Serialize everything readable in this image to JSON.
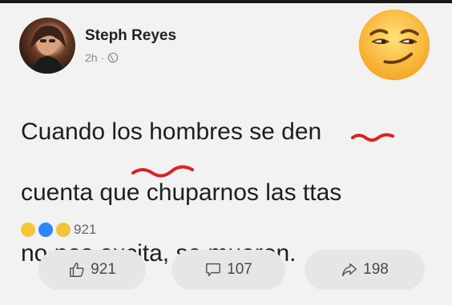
{
  "post": {
    "author": "Steph Reyes",
    "time": "2h",
    "separator": "·",
    "line1": "Cuando los hombres se den",
    "line2": "cuenta que chuparnos las ttas",
    "line3": "no nos excita, se mueren.",
    "reaction_count": "921"
  },
  "actions": {
    "like_count": "921",
    "comment_count": "107",
    "share_count": "198"
  },
  "icons": {
    "emoji": "smirk-emoji-icon",
    "privacy": "globe-icon",
    "like": "thumbs-up-icon",
    "comment": "comment-bubble-icon",
    "share": "share-arrow-icon"
  },
  "colors": {
    "background": "#f2f2f2",
    "text": "#1e1e1e",
    "scribble": "#e02020",
    "button_bg": "#e6e6e6"
  }
}
